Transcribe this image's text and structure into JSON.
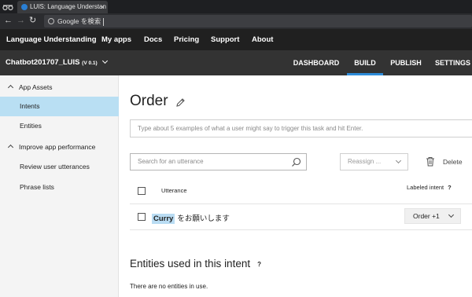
{
  "browser": {
    "tab_title": "LUIS: Language Understan",
    "tab_close": "×",
    "address_text": "Google を検索"
  },
  "topnav": {
    "brand": "Language Understanding",
    "items": [
      "My apps",
      "Docs",
      "Pricing",
      "Support",
      "About"
    ]
  },
  "subnav": {
    "app_name": "Chatbot201707_LUIS",
    "app_version": "(V 0.1)",
    "tabs": [
      "DASHBOARD",
      "BUILD",
      "PUBLISH",
      "SETTINGS"
    ],
    "active_tab": "BUILD",
    "accent_color": "#2e8cd9"
  },
  "sidebar": {
    "sections": [
      {
        "label": "App Assets",
        "items": [
          "Intents",
          "Entities"
        ]
      },
      {
        "label": "Improve app performance",
        "items": [
          "Review user utterances",
          "Phrase lists"
        ]
      }
    ],
    "active_item": "Intents"
  },
  "main": {
    "title": "Order",
    "utterance_placeholder": "Type about 5 examples of what a user might say to trigger this task and hit Enter.",
    "search_placeholder": "Search for an utterance",
    "reassign_label": "Reassign ...",
    "delete_label": "Delete",
    "table": {
      "col_utterance": "Utterance",
      "col_labeled_intent": "Labeled intent",
      "col_help": "?",
      "rows": [
        {
          "entity": "Curry",
          "rest": "をお願いします",
          "intent": "Order +1"
        }
      ]
    },
    "entities_heading": "Entities used in this intent",
    "entities_help": "?",
    "no_entities_text": "There are no entities in use."
  }
}
